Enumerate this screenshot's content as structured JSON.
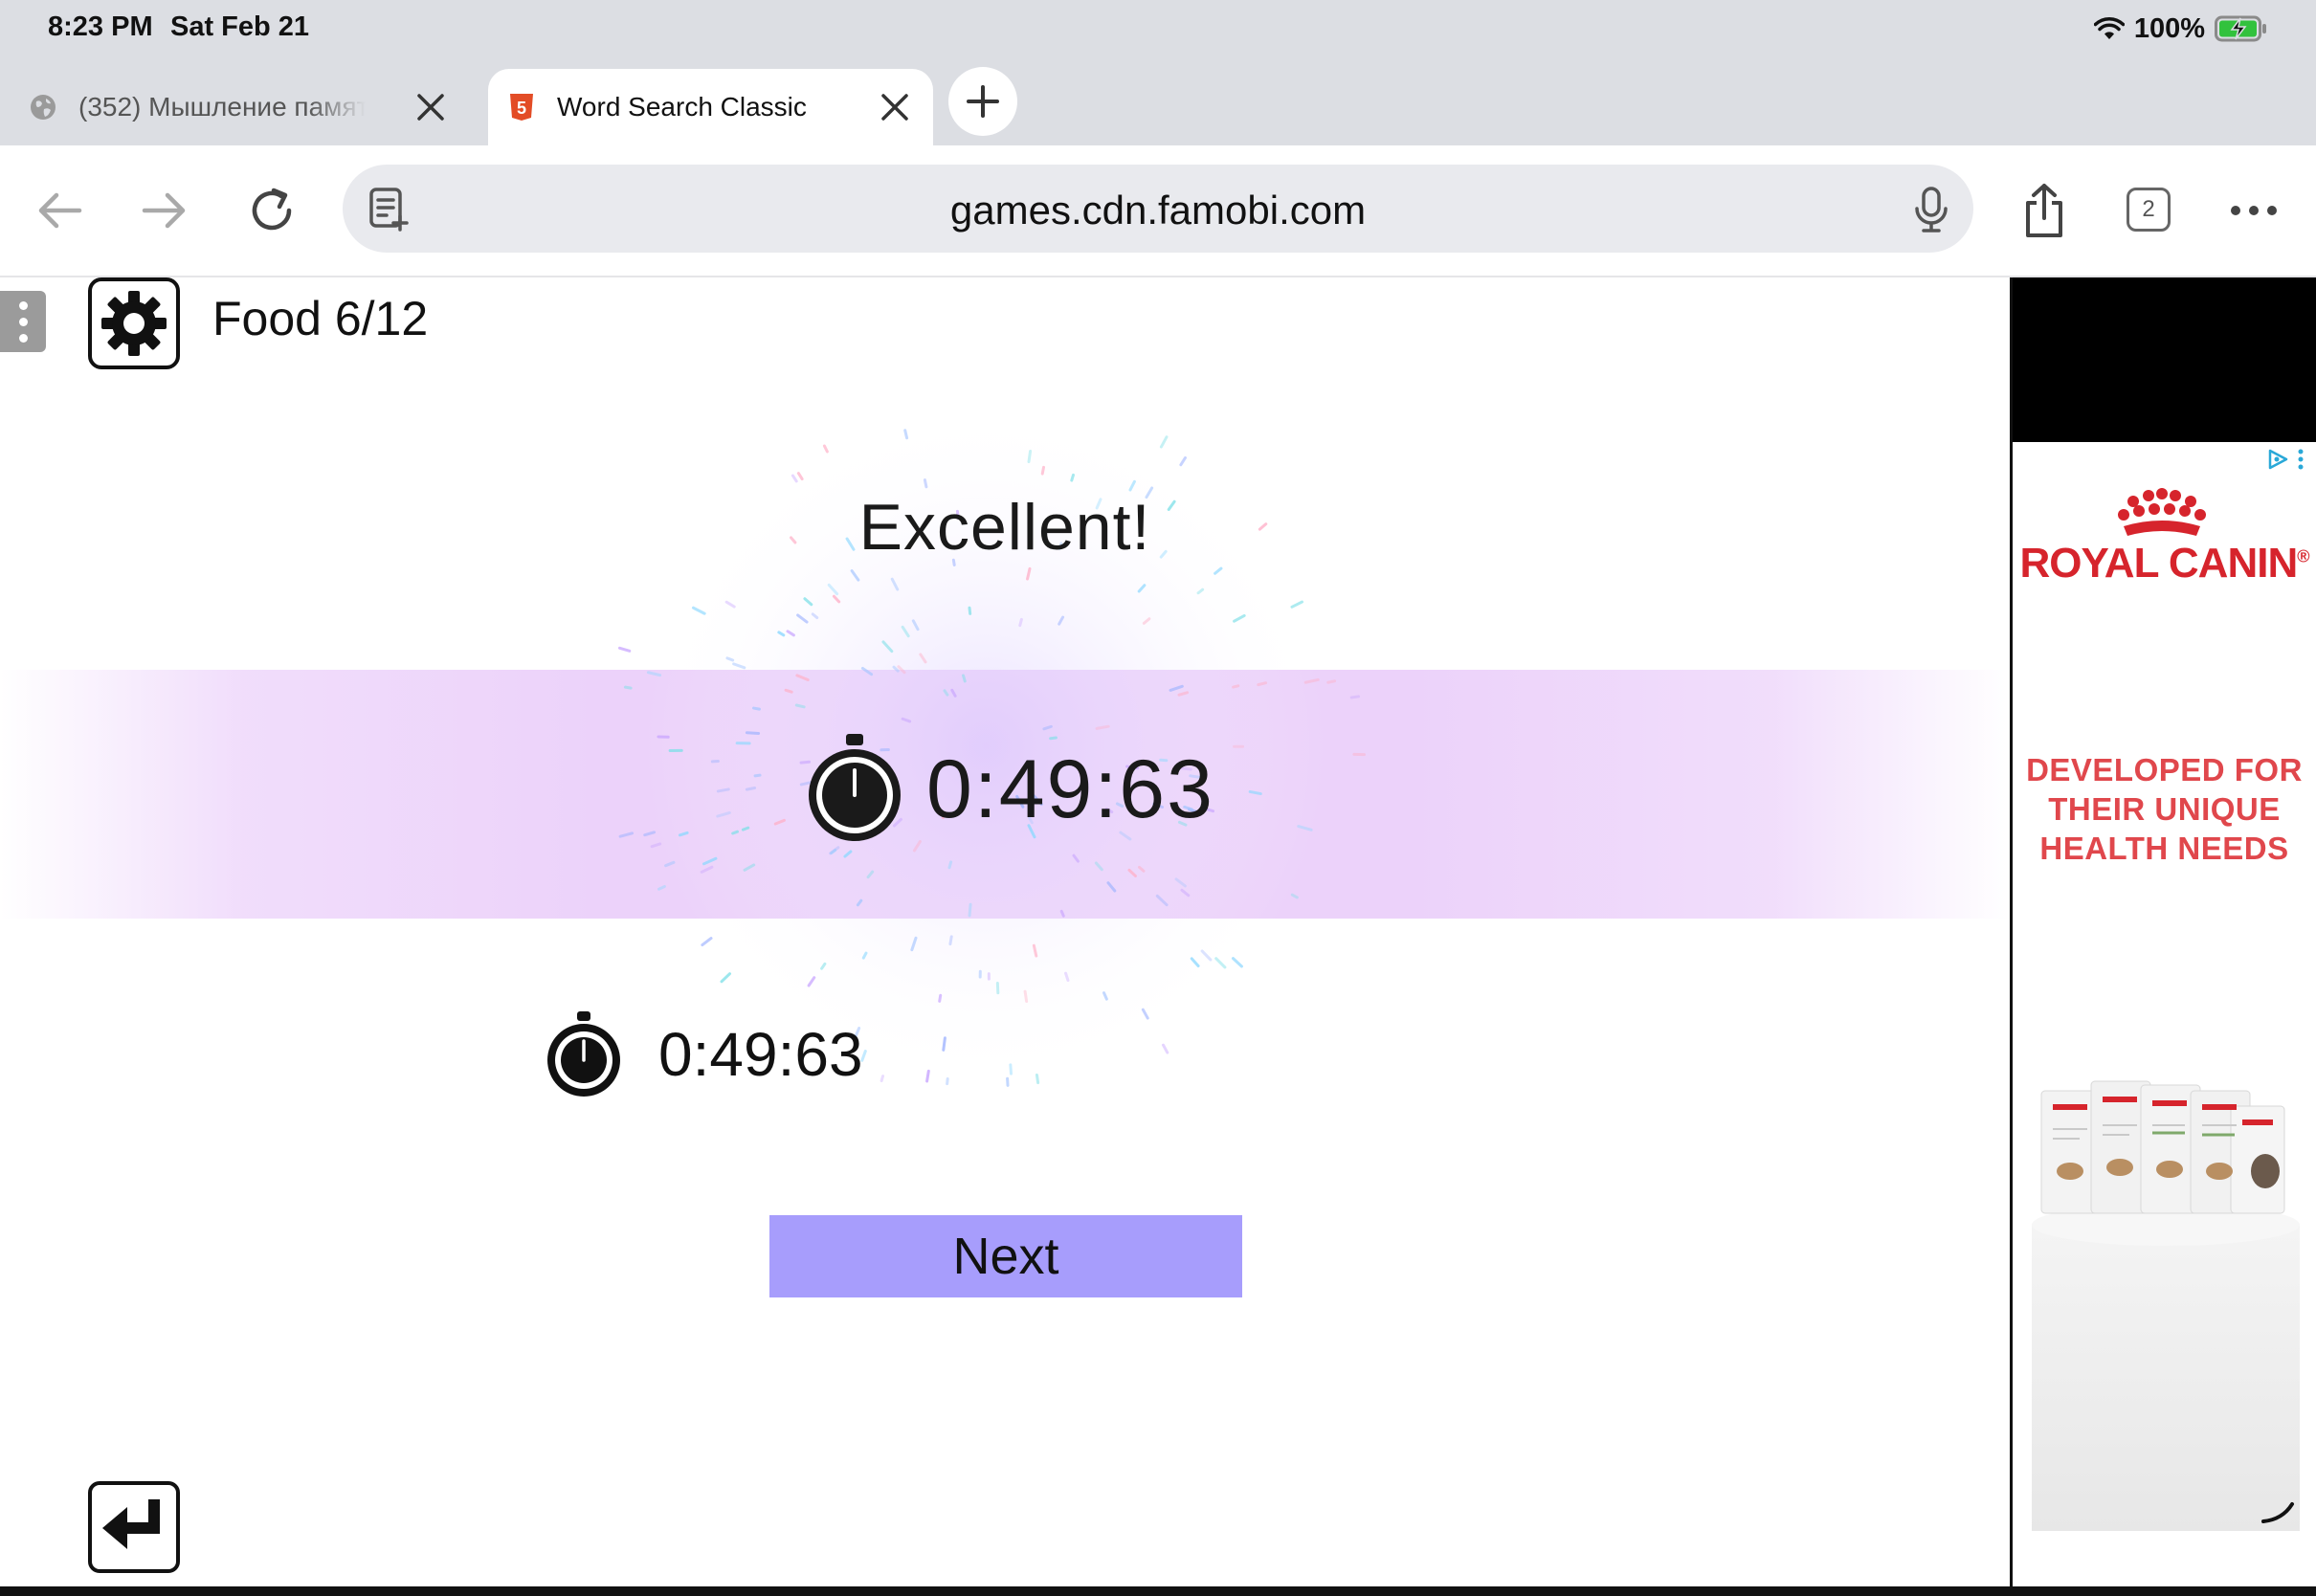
{
  "status_bar": {
    "time": "8:23 PM",
    "date": "Sat Feb 21",
    "battery": "100%"
  },
  "tabs": [
    {
      "title": "(352) Мышление памят",
      "active": false
    },
    {
      "title": "Word Search Classic",
      "active": true
    }
  ],
  "toolbar": {
    "url": "games.cdn.famobi.com",
    "tab_count": "2"
  },
  "game": {
    "level_label": "Food 6/12",
    "result_title": "Excellent!",
    "time_big": "0:49:63",
    "time_small": "0:49:63",
    "next_label": "Next"
  },
  "ad": {
    "brand": "ROYAL CANIN",
    "brand_mark": "®",
    "tagline_lines": [
      "DEVELOPED FOR",
      "THEIR UNIQUE",
      "HEALTH NEEDS"
    ],
    "brand_color": "#d6242c"
  },
  "colors": {
    "band": "#ecd2fa",
    "next_button": "#a79dfc",
    "active_tab": "#ffffff",
    "chrome": "#dcdee3"
  }
}
